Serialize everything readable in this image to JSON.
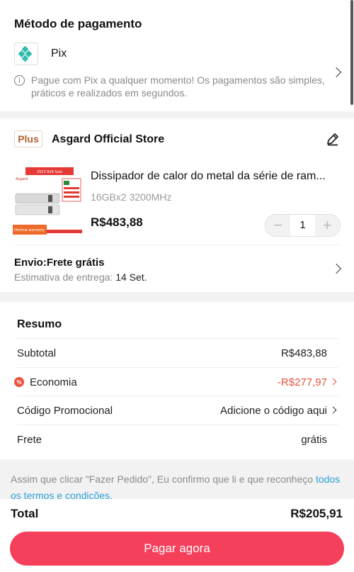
{
  "payment": {
    "title": "Método de pagamento",
    "method": "Pix",
    "method_icon": "pix-icon",
    "info": "Pague com Pix a qualquer momento! Os pagamentos são simples, práticos e realizados em segundos."
  },
  "store": {
    "badge": "Plus",
    "name": "Asgard Official Store",
    "product": {
      "title": "Dissipador de calor do metal da série de ram...",
      "variant": "16GBx2 3200MHz",
      "price": "R$483,88",
      "quantity": "1",
      "thumb_text": {
        "banner": "2023 828 Sale",
        "brand": "Asgard",
        "warranty": "lifetime warranty"
      }
    },
    "shipping": {
      "title": "Envio:Frete grátis",
      "estimate_label": "Estimativa de entrega:",
      "estimate_date": "14 Set."
    }
  },
  "summary": {
    "title": "Resumo",
    "rows": [
      {
        "label": "Subtotal",
        "value": "R$483,88"
      },
      {
        "label": "Economia",
        "value": "-R$277,97"
      },
      {
        "label": "Código Promocional",
        "value": "Adicione o código aqui"
      },
      {
        "label": "Frete",
        "value": "grátis"
      }
    ]
  },
  "terms": {
    "text": "Assim que clicar \"Fazer Pedido\", Eu confirmo que li e que reconheço",
    "link": "todos os termos e condições."
  },
  "footer": {
    "total_label": "Total",
    "total_value": "R$205,91",
    "pay_button": "Pagar agora"
  },
  "colors": {
    "accent": "#f5405b",
    "discount": "#e8523e",
    "link": "#2a9fd6",
    "pix": "#32bcad"
  }
}
